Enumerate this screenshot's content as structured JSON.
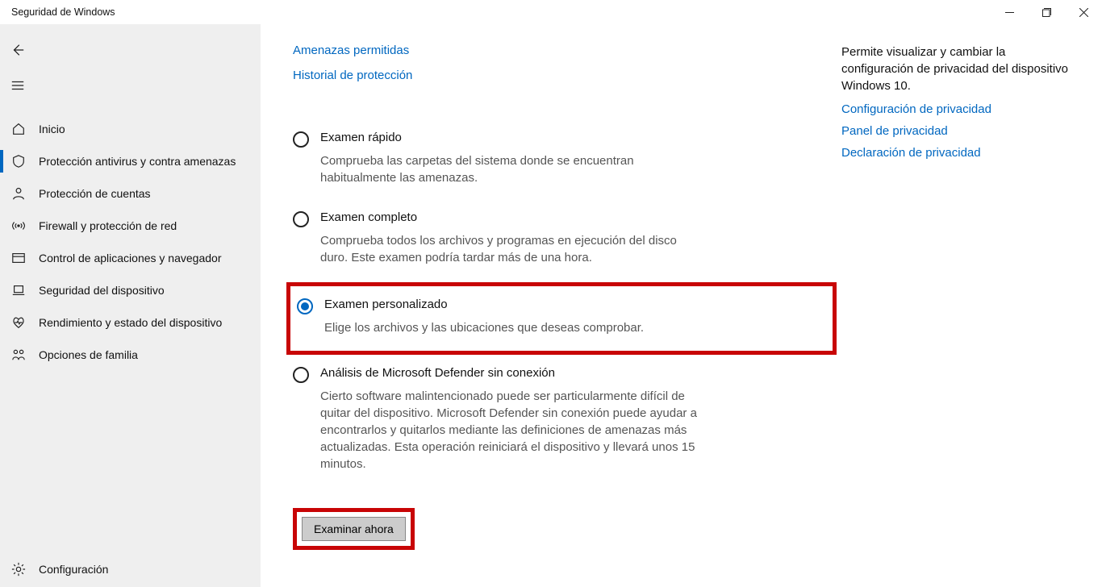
{
  "window": {
    "title": "Seguridad de Windows"
  },
  "sidebar": {
    "items": [
      {
        "label": "Inicio"
      },
      {
        "label": "Protección antivirus y contra amenazas"
      },
      {
        "label": "Protección de cuentas"
      },
      {
        "label": "Firewall y protección de red"
      },
      {
        "label": "Control de aplicaciones y navegador"
      },
      {
        "label": "Seguridad del dispositivo"
      },
      {
        "label": "Rendimiento y estado del dispositivo"
      },
      {
        "label": "Opciones de familia"
      }
    ],
    "settings_label": "Configuración"
  },
  "main": {
    "links": {
      "allowed_threats": "Amenazas permitidas",
      "protection_history": "Historial de protección"
    },
    "options": {
      "quick": {
        "title": "Examen rápido",
        "desc": "Comprueba las carpetas del sistema donde se encuentran habitualmente las amenazas."
      },
      "full": {
        "title": "Examen completo",
        "desc": "Comprueba todos los archivos y programas en ejecución del disco duro. Este examen podría tardar más de una hora."
      },
      "custom": {
        "title": "Examen personalizado",
        "desc": "Elige los archivos y las ubicaciones que deseas comprobar."
      },
      "offline": {
        "title": "Análisis de Microsoft Defender sin conexión",
        "desc": "Cierto software malintencionado puede ser particularmente difícil de quitar del dispositivo. Microsoft Defender sin conexión puede ayudar a encontrarlos y quitarlos mediante las definiciones de amenazas más actualizadas. Esta operación reiniciará el dispositivo y llevará unos 15 minutos."
      }
    },
    "scan_button": "Examinar ahora"
  },
  "right": {
    "desc": "Permite visualizar y cambiar la configuración de privacidad del dispositivo Windows 10.",
    "links": {
      "settings": "Configuración de privacidad",
      "dashboard": "Panel de privacidad",
      "statement": "Declaración de privacidad"
    }
  }
}
